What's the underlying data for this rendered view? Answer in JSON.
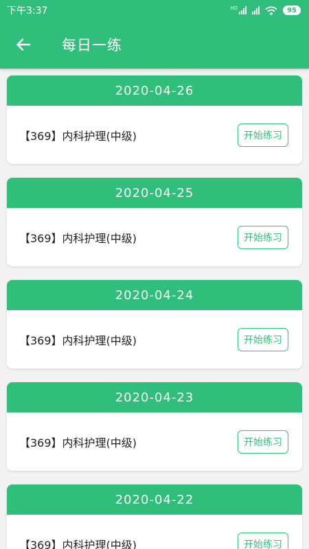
{
  "status_bar": {
    "time": "下午3:37",
    "network_label": "HD",
    "battery": "95",
    "icons": [
      "hd-signal-icon",
      "cell-signal-icon",
      "wifi-icon",
      "battery-icon"
    ]
  },
  "app_bar": {
    "title": "每日一练",
    "back_icon": "arrow-left-icon"
  },
  "colors": {
    "primary": "#2fbf7a",
    "background": "#f2f2f2",
    "card": "#ffffff",
    "text": "#222222"
  },
  "practices": [
    {
      "date": "2020-04-26",
      "course": "【369】内科护理(中级)",
      "button": "开始练习"
    },
    {
      "date": "2020-04-25",
      "course": "【369】内科护理(中级)",
      "button": "开始练习"
    },
    {
      "date": "2020-04-24",
      "course": "【369】内科护理(中级)",
      "button": "开始练习"
    },
    {
      "date": "2020-04-23",
      "course": "【369】内科护理(中级)",
      "button": "开始练习"
    },
    {
      "date": "2020-04-22",
      "course": "【369】内科护理(中级)",
      "button": "开始练习"
    }
  ]
}
